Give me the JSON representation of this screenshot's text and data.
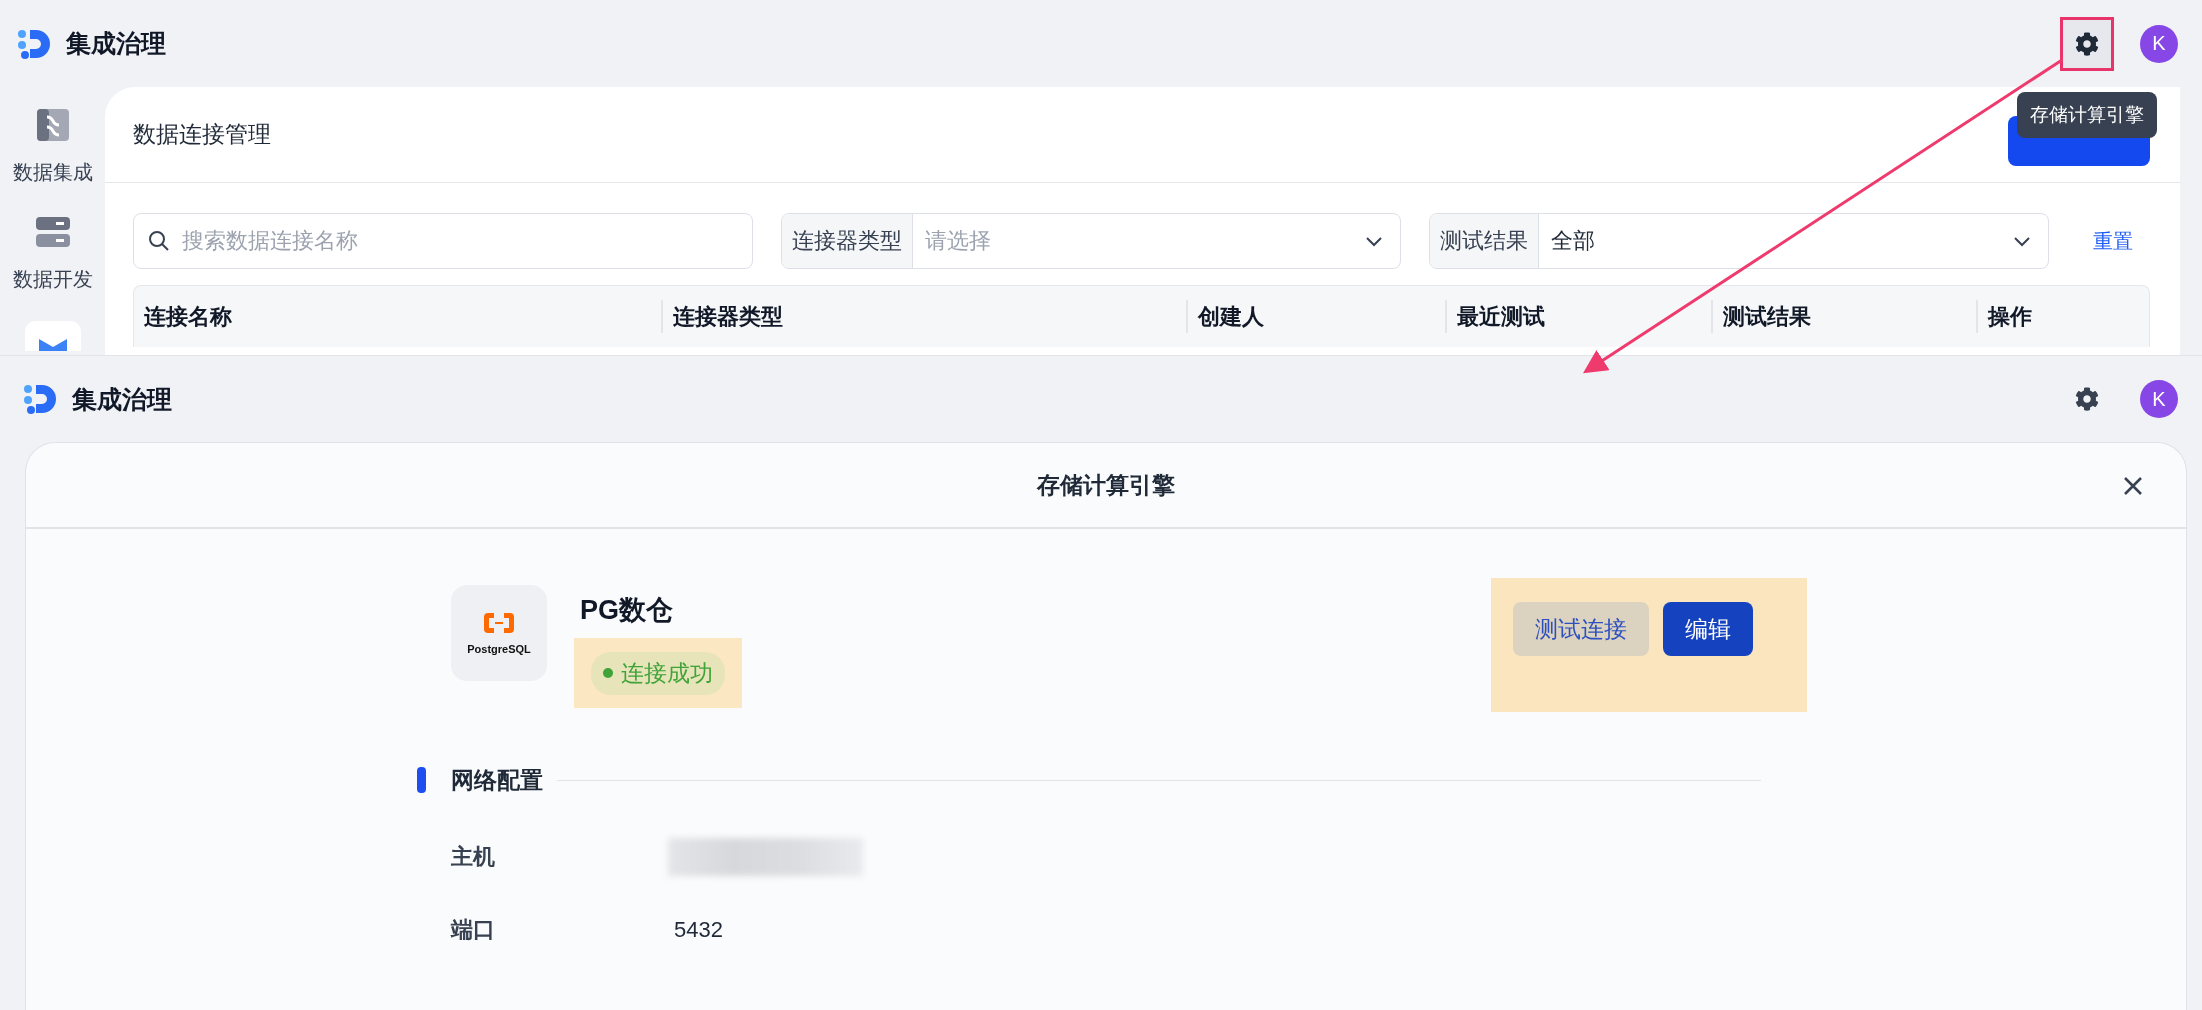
{
  "top_screen": {
    "app_title": "集成治理",
    "avatar": "K",
    "settings_highlighted": true,
    "sidebar": {
      "items": [
        {
          "label": "数据集成",
          "kind": "integration"
        },
        {
          "label": "数据开发",
          "kind": "development"
        }
      ]
    },
    "page_title": "数据连接管理",
    "tooltip": "存储计算引擎",
    "search": {
      "placeholder": "搜索数据连接名称"
    },
    "filters": [
      {
        "label": "连接器类型",
        "placeholder": "请选择"
      },
      {
        "label": "测试结果",
        "value": "全部"
      }
    ],
    "reset": "重置",
    "table": {
      "columns": [
        "连接名称",
        "连接器类型",
        "创建人",
        "最近测试",
        "测试结果",
        "操作"
      ]
    }
  },
  "detail_screen": {
    "app_title": "集成治理",
    "avatar": "K",
    "dialog": {
      "title": "存储计算引擎",
      "name": "PG数仓",
      "logo_caption": "PostgreSQL",
      "status": {
        "label": "连接成功",
        "color": "#3fa33a",
        "highlighted": true
      },
      "actions_highlighted": true,
      "buttons": [
        {
          "label": "测试连接",
          "kind": "secondary"
        },
        {
          "label": "编辑",
          "kind": "primary"
        }
      ],
      "section": "网络配置",
      "fields": [
        {
          "label": "主机",
          "kind": "redacted"
        },
        {
          "label": "端口",
          "kind": "text",
          "value": "5432"
        }
      ]
    }
  }
}
